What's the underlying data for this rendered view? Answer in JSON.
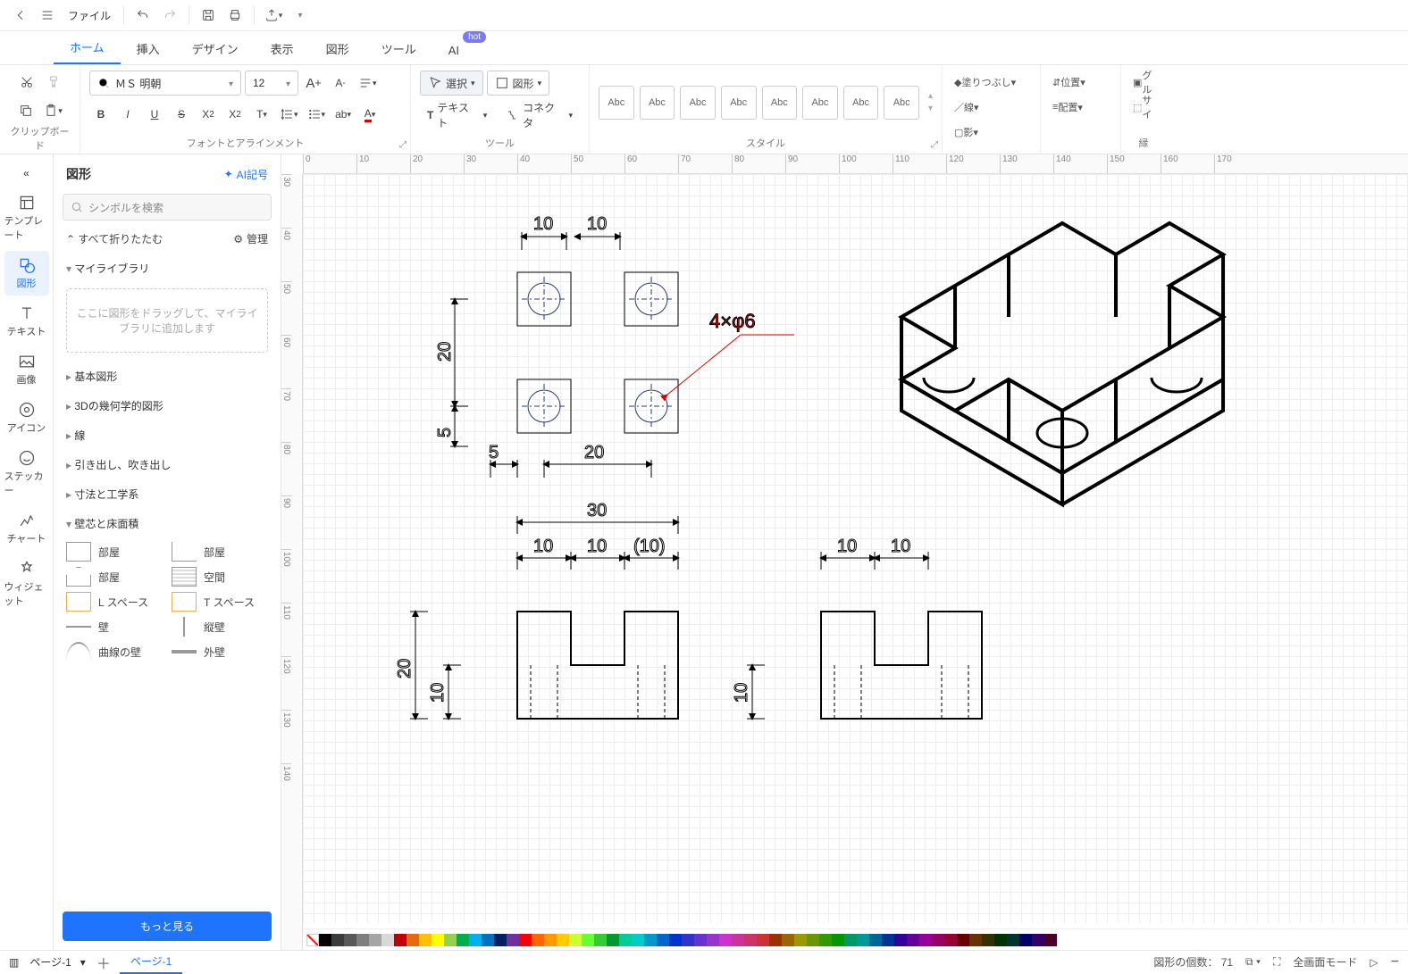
{
  "topbar": {
    "file_label": "ファイル"
  },
  "tabs": {
    "items": [
      "ホーム",
      "挿入",
      "デザイン",
      "表示",
      "図形",
      "ツール",
      "AI"
    ],
    "active": 0,
    "hot_badge": "hot"
  },
  "ribbon": {
    "clipboard_label": "クリップボード",
    "font_group_label": "フォントとアラインメント",
    "font_name": "ＭＳ 明朝",
    "font_size": "12",
    "tool_group_label": "ツール",
    "select_label": "選択",
    "shape_label": "図形",
    "text_label": "テキスト",
    "connector_label": "コネクタ",
    "style_group_label": "スタイル",
    "style_item": "Abc",
    "fill_label": "塗りつぶし",
    "line_label": "線",
    "shadow_label": "影",
    "pos_label": "位置",
    "align_label": "配置",
    "group_hint": "グル",
    "size_hint": "サイ",
    "edge_label": "縁"
  },
  "leftbar": {
    "items": [
      {
        "label": "テンプレート"
      },
      {
        "label": "図形"
      },
      {
        "label": "テキスト"
      },
      {
        "label": "画像"
      },
      {
        "label": "アイコン"
      },
      {
        "label": "ステッカー"
      },
      {
        "label": "チャート"
      },
      {
        "label": "ウィジェット"
      }
    ],
    "active": 1
  },
  "shapes_panel": {
    "title": "図形",
    "ai_label": "AI記号",
    "search_placeholder": "シンボルを検索",
    "fold_all": "すべて折りたたむ",
    "manage": "管理",
    "cat_mylib": "マイライブラリ",
    "drop_hint": "ここに図形をドラッグして、マイライブラリに追加します",
    "cats": [
      "基本図形",
      "3Dの幾何学的図形",
      "線",
      "引き出し、吹き出し",
      "寸法と工学系",
      "壁芯と床面積"
    ],
    "wall_items": [
      {
        "label": "部屋"
      },
      {
        "label": "部屋"
      },
      {
        "label": "部屋"
      },
      {
        "label": "空間"
      },
      {
        "label": "L スペース"
      },
      {
        "label": "T スペース"
      },
      {
        "label": "壁"
      },
      {
        "label": "縦壁"
      },
      {
        "label": "曲線の壁"
      },
      {
        "label": "外壁"
      }
    ],
    "more": "もっと見る"
  },
  "ruler": {
    "h": [
      "0",
      "10",
      "20",
      "30",
      "40",
      "50",
      "60",
      "70",
      "80",
      "90",
      "100",
      "110",
      "120",
      "130",
      "140",
      "150",
      "160",
      "170"
    ],
    "v": [
      "30",
      "40",
      "50",
      "60",
      "70",
      "80",
      "90",
      "100",
      "110",
      "120",
      "130",
      "140"
    ]
  },
  "drawing": {
    "dim_10a": "10",
    "dim_10b": "10",
    "dim_20v": "20",
    "dim_5h": "5",
    "dim_5v": "5",
    "dim_20h": "20",
    "dim_30": "30",
    "dim_10c": "10",
    "dim_10d": "10",
    "dim_10p": "(10)",
    "dim_20v2": "20",
    "dim_10v2": "10",
    "dim_10e": "10",
    "dim_10f": "10",
    "dim_10v3": "10",
    "hole_note": "4×φ6"
  },
  "colorbar": [
    "#000000",
    "#3b3b3b",
    "#595959",
    "#7f7f7f",
    "#a5a5a5",
    "#d8d8d8",
    "#c00000",
    "#e36c09",
    "#ffc000",
    "#ffff00",
    "#92d050",
    "#00b050",
    "#00b0f0",
    "#0070c0",
    "#002060",
    "#7030a0",
    "#ff0000",
    "#ff6600",
    "#ff9900",
    "#ffcc00",
    "#ccff33",
    "#66ff33",
    "#33cc33",
    "#009933",
    "#00cc99",
    "#00cccc",
    "#0099cc",
    "#0066cc",
    "#0033cc",
    "#3333cc",
    "#6633cc",
    "#9933cc",
    "#cc33cc",
    "#cc3399",
    "#cc3366",
    "#cc3333",
    "#993300",
    "#996600",
    "#999900",
    "#669900",
    "#339900",
    "#009900",
    "#009966",
    "#009999",
    "#006699",
    "#003399",
    "#330099",
    "#660099",
    "#990099",
    "#990066",
    "#990033",
    "#660000",
    "#663300",
    "#333300",
    "#003300",
    "#003333",
    "#000066",
    "#330066",
    "#4d0026"
  ],
  "status": {
    "page_sel": "ページ-1",
    "page_tab": "ページ-1",
    "shapecount_label": "図形の個数：",
    "shapecount": "71",
    "fullscreen": "全画面モード"
  }
}
